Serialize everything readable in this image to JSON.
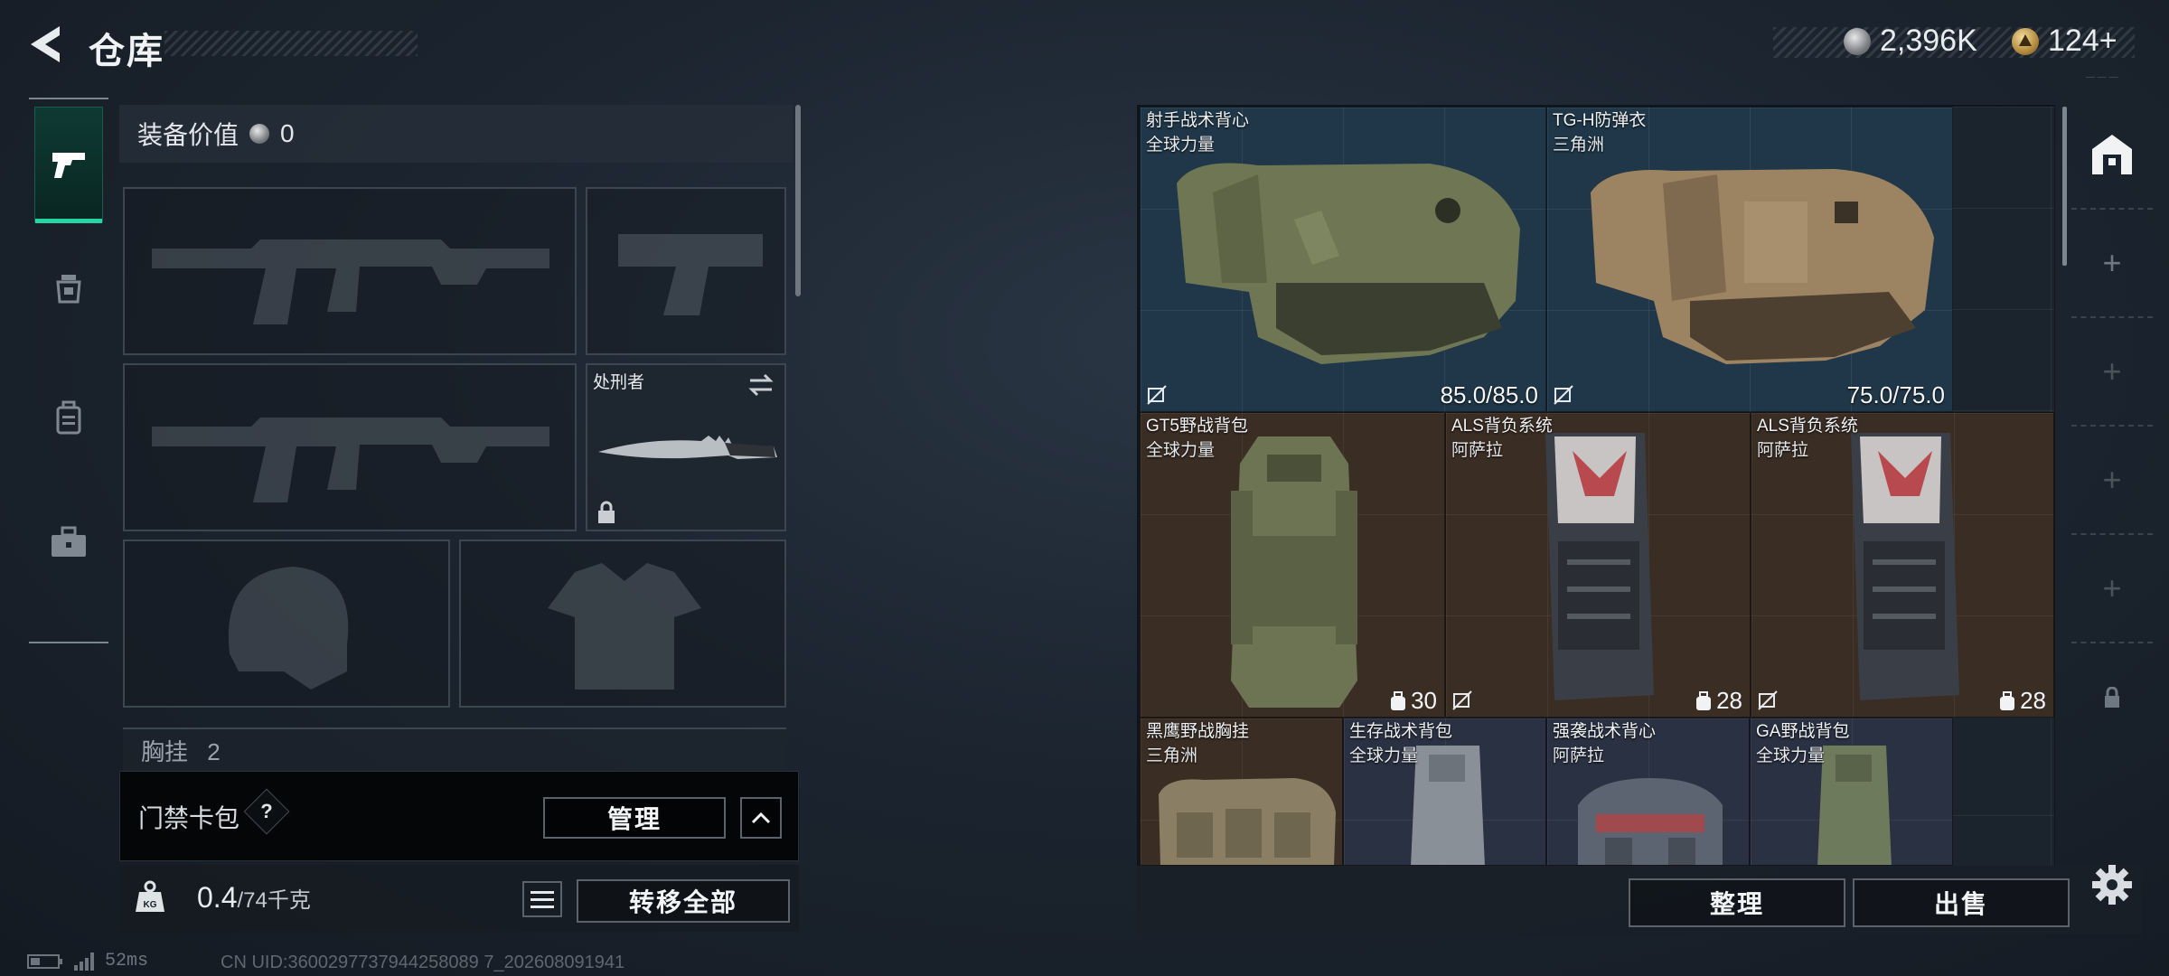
{
  "header": {
    "title": "仓库"
  },
  "currency": {
    "silver": "2,396K",
    "gold": "124+"
  },
  "equipment": {
    "value_label": "装备价值",
    "value": "0",
    "melee_name": "处刑者",
    "chest_section": "胸挂",
    "chest_count": "2"
  },
  "keycard": {
    "label": "门禁卡包",
    "help": "?",
    "manage_label": "管理"
  },
  "inventory": {
    "weight_current": "0.4",
    "weight_max": "/74千克",
    "transfer_all_label": "转移全部"
  },
  "stash": {
    "items": [
      {
        "name": "射手战术背心",
        "sub": "全球力量",
        "durability": "85.0/85.0"
      },
      {
        "name": "TG-H防弹衣",
        "sub": "三角洲",
        "durability": "75.0/75.0"
      },
      {
        "name": "GT5野战背包",
        "sub": "全球力量",
        "capacity": "30"
      },
      {
        "name": "ALS背负系统",
        "sub": "阿萨拉",
        "capacity": "28"
      },
      {
        "name": "ALS背负系统",
        "sub": "阿萨拉",
        "capacity": "28"
      },
      {
        "name": "黑鹰野战胸挂",
        "sub": "三角洲"
      },
      {
        "name": "生存战术背包",
        "sub": "全球力量"
      },
      {
        "name": "强袭战术背心",
        "sub": "阿萨拉"
      },
      {
        "name": "GA野战背包",
        "sub": "全球力量"
      }
    ],
    "sort_label": "整理",
    "sell_label": "出售"
  },
  "status": {
    "ping": "52ms",
    "uid": "CN UID:3600297737944258089 7_202608091941"
  },
  "icons": {
    "back": "back-arrow-icon",
    "nav": [
      "pistol-icon",
      "lightbulb-icon",
      "backpack-icon",
      "toolbox-icon"
    ],
    "rail": [
      "stash-home-icon",
      "plus-icon",
      "lock-icon"
    ],
    "settings": "gear-icon"
  },
  "colors": {
    "accent": "#23d6a3",
    "stash_blue": "#1f3748",
    "stash_brown": "#3a2d24"
  }
}
